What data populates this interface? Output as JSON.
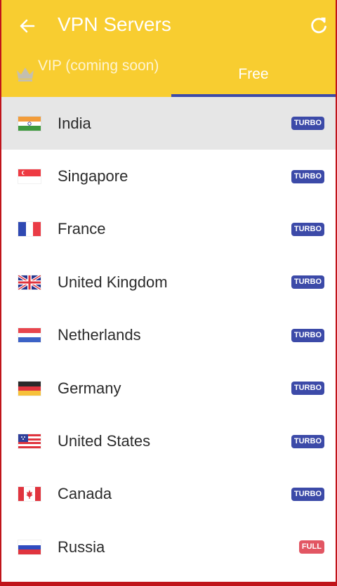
{
  "colors": {
    "primary": "#f8cd30",
    "accent": "#3c4aa8",
    "turbo_badge": "#3c4aa8",
    "full_badge": "#e25663",
    "selected_row": "#e6e6e6"
  },
  "appbar": {
    "title": "VPN Servers",
    "back_icon": "arrow-left-icon",
    "refresh_icon": "refresh-icon"
  },
  "tabs": [
    {
      "label": "VIP (coming soon)",
      "icon": "crown-icon",
      "selected": false
    },
    {
      "label": "Free",
      "selected": true
    }
  ],
  "servers": [
    {
      "name": "India",
      "flag": "india-flag-icon",
      "badge": "TURBO",
      "badge_type": "turbo",
      "selected": true
    },
    {
      "name": "Singapore",
      "flag": "singapore-flag-icon",
      "badge": "TURBO",
      "badge_type": "turbo",
      "selected": false
    },
    {
      "name": "France",
      "flag": "france-flag-icon",
      "badge": "TURBO",
      "badge_type": "turbo",
      "selected": false
    },
    {
      "name": "United Kingdom",
      "flag": "uk-flag-icon",
      "badge": "TURBO",
      "badge_type": "turbo",
      "selected": false
    },
    {
      "name": "Netherlands",
      "flag": "netherlands-flag-icon",
      "badge": "TURBO",
      "badge_type": "turbo",
      "selected": false
    },
    {
      "name": "Germany",
      "flag": "germany-flag-icon",
      "badge": "TURBO",
      "badge_type": "turbo",
      "selected": false
    },
    {
      "name": "United States",
      "flag": "us-flag-icon",
      "badge": "TURBO",
      "badge_type": "turbo",
      "selected": false
    },
    {
      "name": "Canada",
      "flag": "canada-flag-icon",
      "badge": "TURBO",
      "badge_type": "turbo",
      "selected": false
    },
    {
      "name": "Russia",
      "flag": "russia-flag-icon",
      "badge": "FULL",
      "badge_type": "full",
      "selected": false
    }
  ]
}
